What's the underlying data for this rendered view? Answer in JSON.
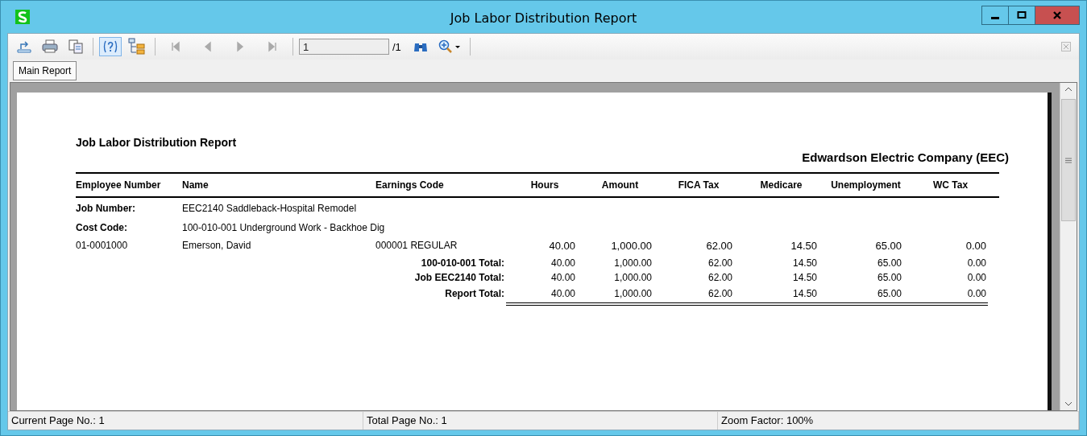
{
  "window": {
    "title": "Job Labor Distribution Report"
  },
  "toolbar": {
    "nav_buttons": [
      {
        "kind": "first",
        "disabled": true
      },
      {
        "kind": "prev",
        "disabled": true
      },
      {
        "kind": "next",
        "disabled": true
      },
      {
        "kind": "last",
        "disabled": true
      }
    ],
    "page_field": {
      "value": "1"
    },
    "page_count": "/1",
    "help_on": true
  },
  "tabs": [
    {
      "label": "Main Report",
      "selected": true
    }
  ],
  "report": {
    "title": "Job Labor Distribution Report",
    "company": "Edwardson Electric Company (EEC)",
    "columns": [
      "Employee Number",
      "Name",
      "Earnings Code",
      "Hours",
      "Amount",
      "FICA Tax",
      "Medicare",
      "Unemployment",
      "WC Tax"
    ],
    "groups": [
      {
        "label": "Job Number:",
        "value": "EEC2140 Saddleback-Hospital Remodel"
      },
      {
        "label": "Cost Code:",
        "value": "100-010-001 Underground Work - Backhoe Dig"
      }
    ],
    "detail": {
      "employee": "01-0001000",
      "name": "Emerson, David",
      "earnings_code": "000001 REGULAR",
      "values": [
        "40.00",
        "1,000.00",
        "62.00",
        "14.50",
        "65.00",
        "0.00"
      ]
    },
    "totals": [
      {
        "label": "100-010-001 Total:",
        "values": [
          "40.00",
          "1,000.00",
          "62.00",
          "14.50",
          "65.00",
          "0.00"
        ]
      },
      {
        "label": "Job EEC2140 Total:",
        "values": [
          "40.00",
          "1,000.00",
          "62.00",
          "14.50",
          "65.00",
          "0.00"
        ]
      },
      {
        "label": "Report Total:",
        "values": [
          "40.00",
          "1,000.00",
          "62.00",
          "14.50",
          "65.00",
          "0.00"
        ]
      }
    ]
  },
  "status_bar": [
    "Current Page No.: 1",
    "Total Page No.: 1",
    "Zoom Factor: 100%"
  ]
}
